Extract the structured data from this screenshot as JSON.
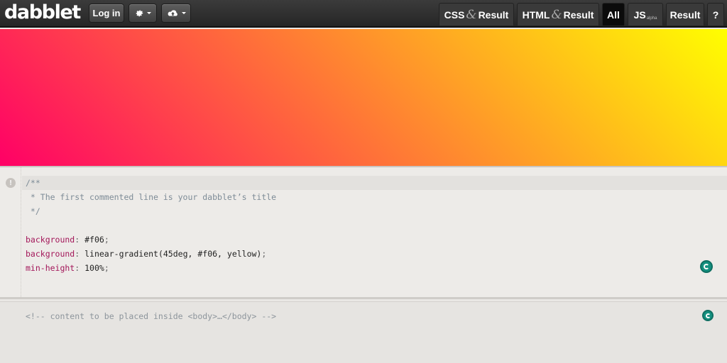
{
  "app": {
    "logo_text": "dabblet"
  },
  "toolbar": {
    "login_label": "Log in",
    "settings_icon": "gear-icon",
    "cloud_icon": "cloud-upload-icon"
  },
  "tabs": [
    {
      "label_a": "CSS",
      "amp": "&",
      "label_b": "Result"
    },
    {
      "label_a": "HTML",
      "amp": "&",
      "label_b": "Result"
    },
    {
      "label": "All",
      "active": true
    },
    {
      "label": "JS",
      "sub": "alpha"
    },
    {
      "label": "Result"
    },
    {
      "label": "?"
    }
  ],
  "result": {
    "gradient_from": "#ff0066",
    "gradient_to": "#ffff00",
    "angle": "45deg"
  },
  "css_editor": {
    "line_badge": "!",
    "lines": [
      "/**",
      " * The first commented line is your dabblet’s title",
      " */",
      "",
      "background: #f06;",
      "background: linear-gradient(45deg, #f06, yellow);",
      "min-height: 100%;"
    ],
    "decl": [
      {
        "prop": "background",
        "value": "#f06"
      },
      {
        "prop": "background",
        "value": "linear-gradient(45deg, #f06, yellow)"
      },
      {
        "prop": "min-height",
        "value": "100%"
      }
    ]
  },
  "html_editor": {
    "line": "<!-- content to be placed inside <body>…</body> -->"
  },
  "colors": {
    "accent": "#14907f",
    "topbar": "#2c2c2c"
  }
}
